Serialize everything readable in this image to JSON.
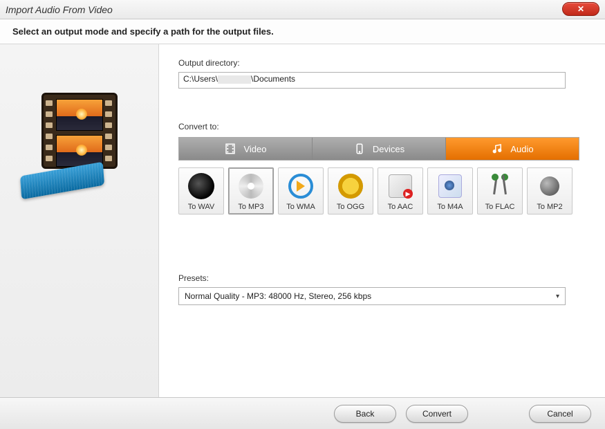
{
  "window": {
    "title": "Import Audio From Video"
  },
  "instruction": "Select an output mode and specify a path for the output files.",
  "output": {
    "label": "Output directory:",
    "path_prefix": "C:\\Users\\",
    "path_suffix": "\\Documents"
  },
  "convert": {
    "label": "Convert to:",
    "tabs": [
      {
        "id": "video",
        "label": "Video",
        "active": false
      },
      {
        "id": "devices",
        "label": "Devices",
        "active": false
      },
      {
        "id": "audio",
        "label": "Audio",
        "active": true
      }
    ],
    "formats": [
      {
        "id": "wav",
        "label": "To WAV",
        "selected": false
      },
      {
        "id": "mp3",
        "label": "To MP3",
        "selected": true
      },
      {
        "id": "wma",
        "label": "To WMA",
        "selected": false
      },
      {
        "id": "ogg",
        "label": "To OGG",
        "selected": false
      },
      {
        "id": "aac",
        "label": "To AAC",
        "selected": false
      },
      {
        "id": "m4a",
        "label": "To M4A",
        "selected": false
      },
      {
        "id": "flac",
        "label": "To FLAC",
        "selected": false
      },
      {
        "id": "mp2",
        "label": "To MP2",
        "selected": false
      }
    ]
  },
  "presets": {
    "label": "Presets:",
    "selected": "Normal Quality - MP3: 48000 Hz, Stereo, 256 kbps"
  },
  "footer": {
    "back": "Back",
    "convert": "Convert",
    "cancel": "Cancel"
  }
}
